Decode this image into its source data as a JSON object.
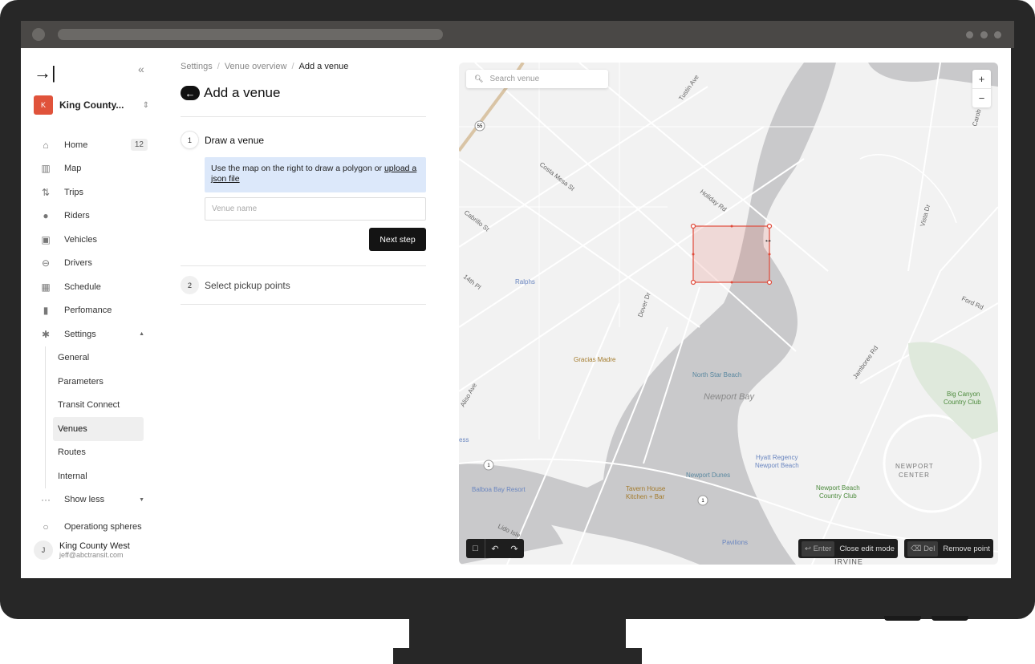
{
  "sidebar": {
    "logo": "→|",
    "collapse": "«",
    "org": {
      "initial": "K",
      "name": "King County...",
      "color": "#e0533b"
    },
    "items": [
      {
        "label": "Home",
        "icon": "home-icon",
        "badge": "12"
      },
      {
        "label": "Map",
        "icon": "map-icon"
      },
      {
        "label": "Trips",
        "icon": "trips-icon"
      },
      {
        "label": "Riders",
        "icon": "person-icon"
      },
      {
        "label": "Vehicles",
        "icon": "bus-icon"
      },
      {
        "label": "Drivers",
        "icon": "steering-wheel-icon"
      },
      {
        "label": "Schedule",
        "icon": "calendar-icon"
      },
      {
        "label": "Perfomance",
        "icon": "bar-chart-icon"
      },
      {
        "label": "Settings",
        "icon": "gear-icon"
      }
    ],
    "settings_sub": [
      "General",
      "Parameters",
      "Transit Connect",
      "Venues",
      "Routes",
      "Internal"
    ],
    "active_sub": "Venues",
    "show_less": "Show less",
    "operating": "Operationg spheres",
    "user": {
      "initial": "J",
      "name": "King County West",
      "email": "jeff@abctransit.com"
    }
  },
  "breadcrumb": [
    "Settings",
    "Venue overview",
    "Add a venue"
  ],
  "page_title": "Add a venue",
  "steps": [
    {
      "num": "1",
      "label": "Draw a venue"
    },
    {
      "num": "2",
      "label": "Select pickup points"
    }
  ],
  "info": {
    "text": "Use the map on the right to draw a polygon or ",
    "link": "upload a json file"
  },
  "venue_input": {
    "placeholder": "Venue name",
    "value": ""
  },
  "next_button": "Next step",
  "map": {
    "search_placeholder": "Search venue",
    "zoom_in": "+",
    "zoom_out": "−",
    "hints": [
      {
        "key": "↩ Enter",
        "label": "Close edit mode"
      },
      {
        "key": "⌫ Del",
        "label": "Remove point"
      }
    ],
    "polygon_color": "#e04a3a",
    "streets": [
      "Tustin Ave",
      "Costa Mesa St",
      "Holiday Rd",
      "Cabrillo St",
      "14th Pl",
      "Dover Dr",
      "Aliso Ave",
      "Jamboree Rd",
      "Ford Rd",
      "Vista Dr",
      "Lido Isle",
      "Carob"
    ],
    "places": [
      "Ralphs",
      "Gracias Madre",
      "North Star Beach",
      "Newport Bay",
      "Hyatt Regency",
      "Newport Beach",
      "Newport Dunes",
      "Tavern House",
      "Kitchen + Bar",
      "Balboa Bay Resort",
      "Pavilions",
      "Big Canyon",
      "Country Club",
      "Newport Beach",
      "Country Club",
      "NEWPORT",
      "CENTER",
      "IRVINE",
      "ess"
    ],
    "shields": [
      "55",
      "1",
      "1"
    ]
  }
}
